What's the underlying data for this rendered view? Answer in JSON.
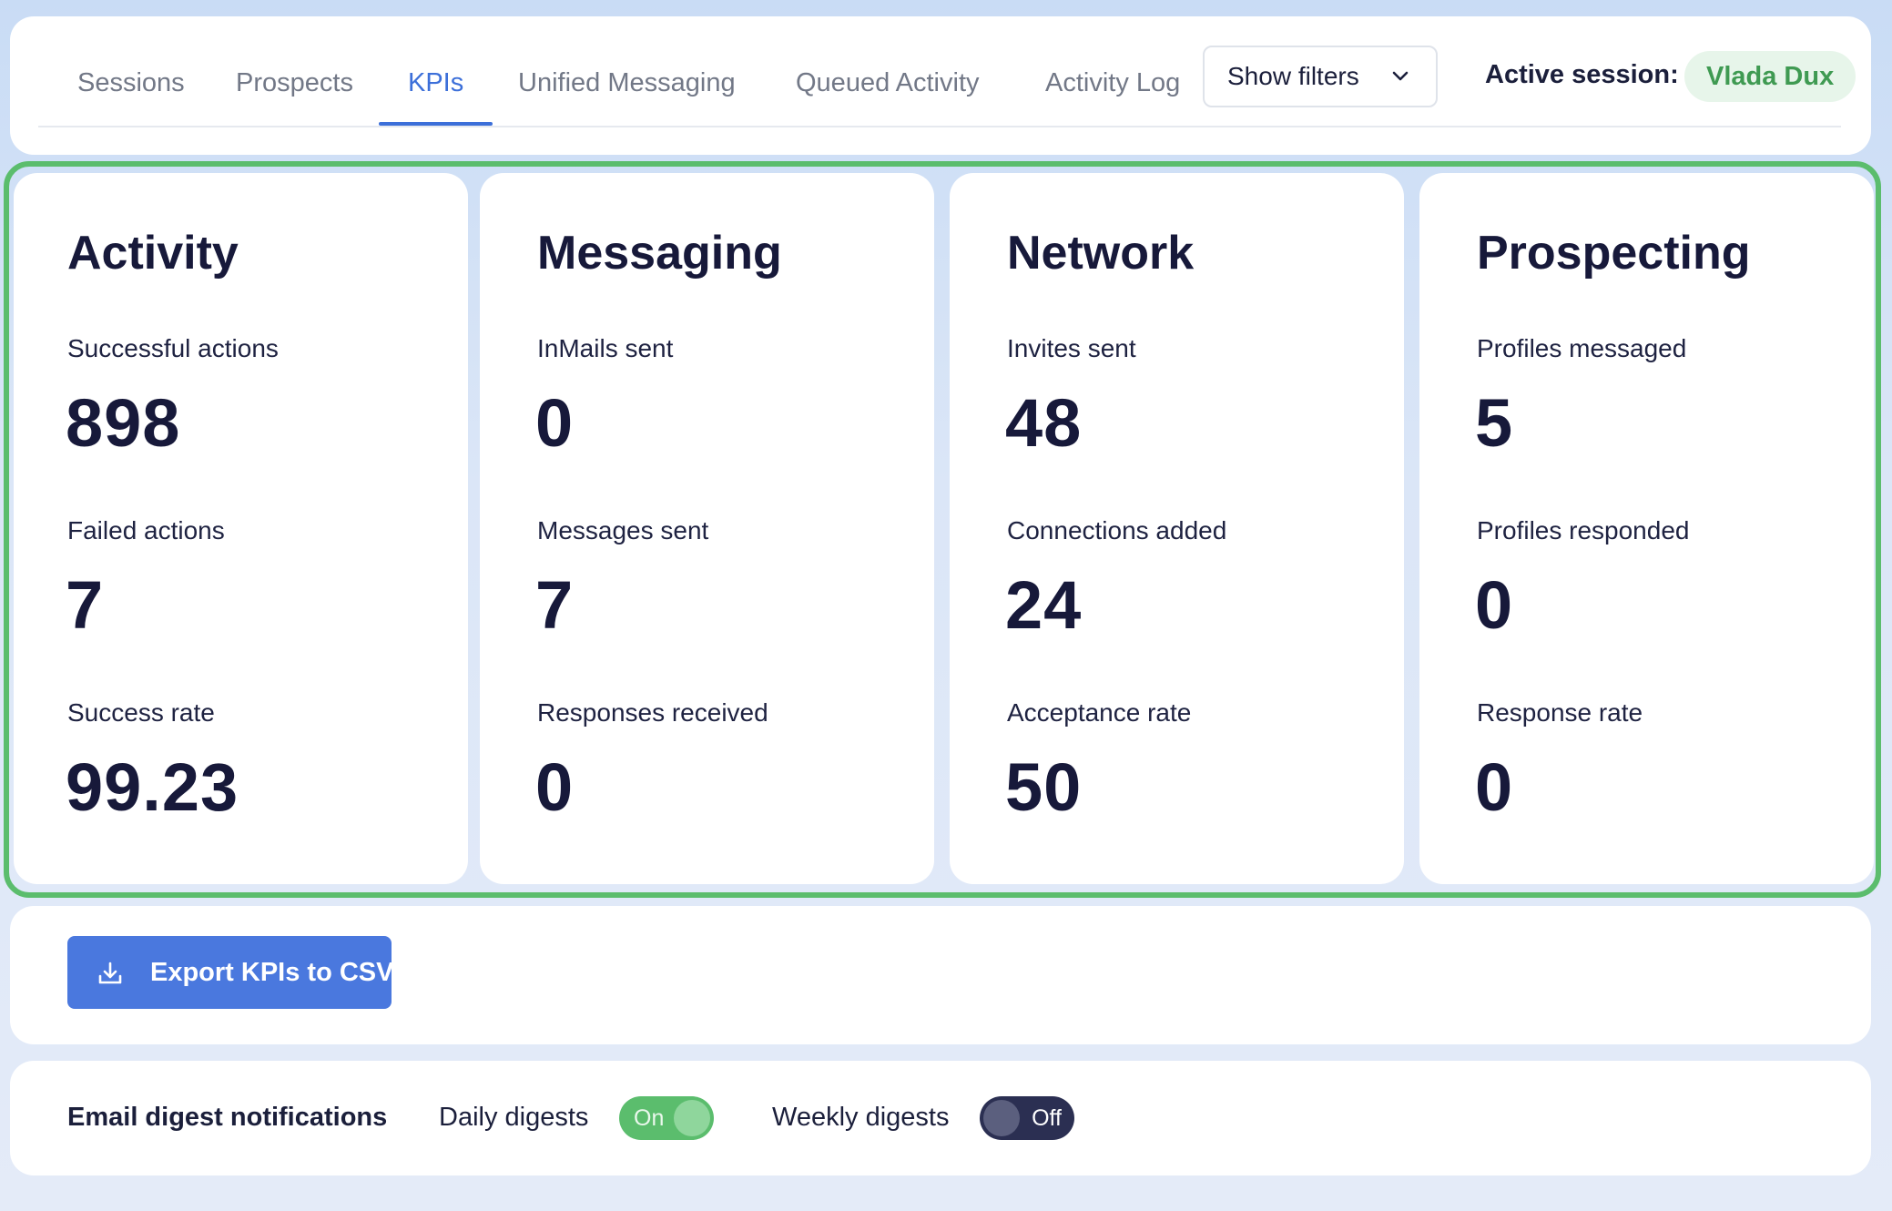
{
  "nav": {
    "tabs": [
      {
        "label": "Sessions"
      },
      {
        "label": "Prospects"
      },
      {
        "label": "KPIs",
        "active": true
      },
      {
        "label": "Unified Messaging"
      },
      {
        "label": "Queued Activity"
      },
      {
        "label": "Activity Log"
      }
    ],
    "filters_label": "Show filters",
    "active_session_label": "Active session:",
    "active_session_name": "Vlada Dux"
  },
  "kpis": [
    {
      "title": "Activity",
      "metrics": [
        {
          "label": "Successful actions",
          "value": "898"
        },
        {
          "label": "Failed actions",
          "value": "7"
        },
        {
          "label": "Success rate",
          "value": "99.23"
        }
      ]
    },
    {
      "title": "Messaging",
      "metrics": [
        {
          "label": "InMails sent",
          "value": "0"
        },
        {
          "label": "Messages sent",
          "value": "7"
        },
        {
          "label": "Responses received",
          "value": "0"
        }
      ]
    },
    {
      "title": "Network",
      "metrics": [
        {
          "label": "Invites sent",
          "value": "48"
        },
        {
          "label": "Connections added",
          "value": "24"
        },
        {
          "label": "Acceptance rate",
          "value": "50"
        }
      ]
    },
    {
      "title": "Prospecting",
      "metrics": [
        {
          "label": "Profiles messaged",
          "value": "5"
        },
        {
          "label": "Profiles responded",
          "value": "0"
        },
        {
          "label": "Response rate",
          "value": "0"
        }
      ]
    }
  ],
  "export": {
    "label": "Export KPIs to CSV",
    "icon": "download-icon"
  },
  "digests": {
    "title": "Email digest notifications",
    "daily": {
      "label": "Daily digests",
      "state": "On"
    },
    "weekly": {
      "label": "Weekly digests",
      "state": "Off"
    }
  },
  "colors": {
    "accent": "#3c6fd9",
    "button": "#4a78de",
    "highlight_green": "#5bbd6d",
    "dark_toggle": "#2b2f52",
    "text_dark": "#17193a"
  }
}
